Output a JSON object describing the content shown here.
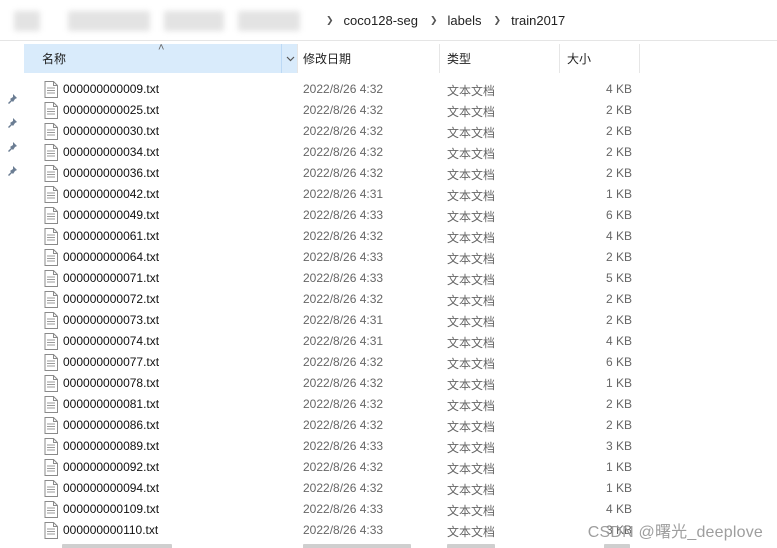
{
  "breadcrumbs": [
    "coco128-seg",
    "labels",
    "train2017"
  ],
  "columns": {
    "name": "名称",
    "date": "修改日期",
    "type": "类型",
    "size": "大小"
  },
  "files": [
    {
      "name": "000000000009.txt",
      "date": "2022/8/26 4:32",
      "type": "文本文档",
      "size": "4 KB"
    },
    {
      "name": "000000000025.txt",
      "date": "2022/8/26 4:32",
      "type": "文本文档",
      "size": "2 KB"
    },
    {
      "name": "000000000030.txt",
      "date": "2022/8/26 4:32",
      "type": "文本文档",
      "size": "2 KB"
    },
    {
      "name": "000000000034.txt",
      "date": "2022/8/26 4:32",
      "type": "文本文档",
      "size": "2 KB"
    },
    {
      "name": "000000000036.txt",
      "date": "2022/8/26 4:32",
      "type": "文本文档",
      "size": "2 KB"
    },
    {
      "name": "000000000042.txt",
      "date": "2022/8/26 4:31",
      "type": "文本文档",
      "size": "1 KB"
    },
    {
      "name": "000000000049.txt",
      "date": "2022/8/26 4:33",
      "type": "文本文档",
      "size": "6 KB"
    },
    {
      "name": "000000000061.txt",
      "date": "2022/8/26 4:32",
      "type": "文本文档",
      "size": "4 KB"
    },
    {
      "name": "000000000064.txt",
      "date": "2022/8/26 4:33",
      "type": "文本文档",
      "size": "2 KB"
    },
    {
      "name": "000000000071.txt",
      "date": "2022/8/26 4:33",
      "type": "文本文档",
      "size": "5 KB"
    },
    {
      "name": "000000000072.txt",
      "date": "2022/8/26 4:32",
      "type": "文本文档",
      "size": "2 KB"
    },
    {
      "name": "000000000073.txt",
      "date": "2022/8/26 4:31",
      "type": "文本文档",
      "size": "2 KB"
    },
    {
      "name": "000000000074.txt",
      "date": "2022/8/26 4:31",
      "type": "文本文档",
      "size": "4 KB"
    },
    {
      "name": "000000000077.txt",
      "date": "2022/8/26 4:32",
      "type": "文本文档",
      "size": "6 KB"
    },
    {
      "name": "000000000078.txt",
      "date": "2022/8/26 4:32",
      "type": "文本文档",
      "size": "1 KB"
    },
    {
      "name": "000000000081.txt",
      "date": "2022/8/26 4:32",
      "type": "文本文档",
      "size": "2 KB"
    },
    {
      "name": "000000000086.txt",
      "date": "2022/8/26 4:32",
      "type": "文本文档",
      "size": "2 KB"
    },
    {
      "name": "000000000089.txt",
      "date": "2022/8/26 4:33",
      "type": "文本文档",
      "size": "3 KB"
    },
    {
      "name": "000000000092.txt",
      "date": "2022/8/26 4:32",
      "type": "文本文档",
      "size": "1 KB"
    },
    {
      "name": "000000000094.txt",
      "date": "2022/8/26 4:32",
      "type": "文本文档",
      "size": "1 KB"
    },
    {
      "name": "000000000109.txt",
      "date": "2022/8/26 4:33",
      "type": "文本文档",
      "size": "4 KB"
    },
    {
      "name": "000000000110.txt",
      "date": "2022/8/26 4:33",
      "type": "文本文档",
      "size": "3 KB"
    }
  ],
  "watermark": "CSDN @曙光_deeplove",
  "colors": {
    "header_selected": "#d9ebfb",
    "pin": "#6b7d93"
  },
  "icons": {
    "sort": "chevron-up-icon",
    "dropdown": "chevron-down-icon",
    "file": "text-file-icon",
    "pin": "pin-icon",
    "separator": "chevron-right-icon"
  }
}
